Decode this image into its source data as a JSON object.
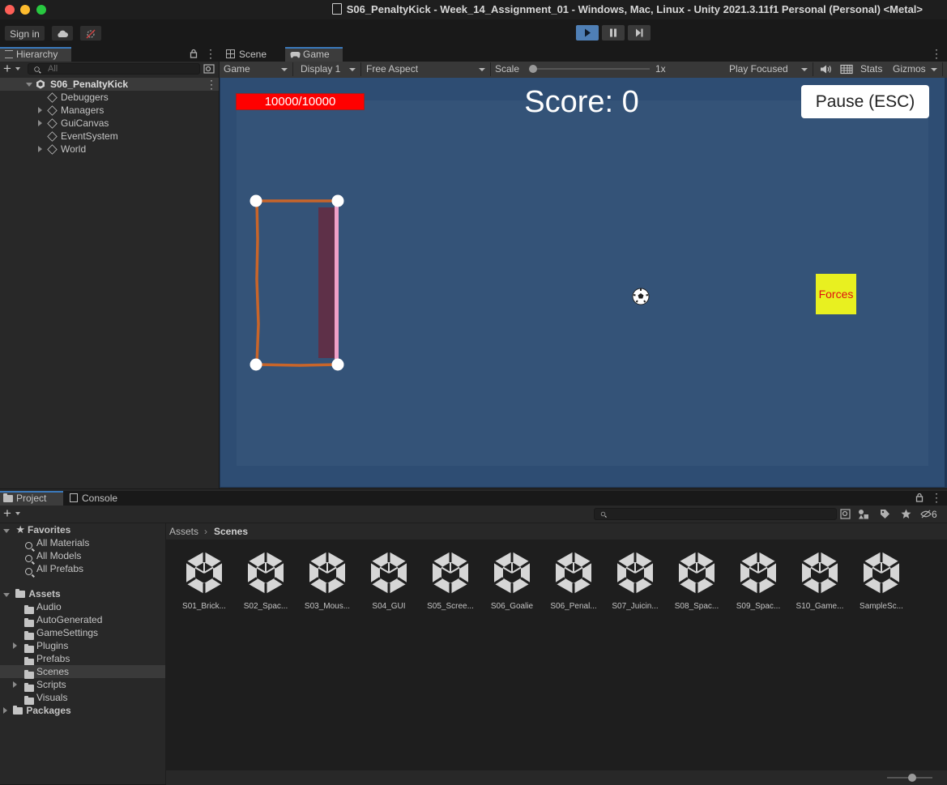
{
  "window": {
    "title": "S06_PenaltyKick - Week_14_Assignment_01 - Windows, Mac, Linux - Unity 2021.3.11f1 Personal (Personal) <Metal>"
  },
  "toolbar": {
    "sign_in": "Sign in"
  },
  "hierarchy": {
    "tab": "Hierarchy",
    "search_placeholder": "All",
    "scene": "S06_PenaltyKick",
    "items": [
      {
        "label": "Debuggers",
        "expandable": false
      },
      {
        "label": "Managers",
        "expandable": true
      },
      {
        "label": "GuiCanvas",
        "expandable": true
      },
      {
        "label": "EventSystem",
        "expandable": false
      },
      {
        "label": "World",
        "expandable": true
      }
    ]
  },
  "view_tabs": {
    "scene": "Scene",
    "game": "Game"
  },
  "game_toolbar": {
    "mode": "Game",
    "display": "Display 1",
    "aspect": "Free Aspect",
    "scale_label": "Scale",
    "scale_value": "1x",
    "play_focused": "Play Focused",
    "stats": "Stats",
    "gizmos": "Gizmos"
  },
  "game": {
    "health": "10000/10000",
    "health_fraction": 1.0,
    "score": "Score: 0",
    "pause": "Pause (ESC)",
    "forces": "Forces"
  },
  "bottom_tabs": {
    "project": "Project",
    "console": "Console"
  },
  "project": {
    "hidden_count": "6",
    "favorites": {
      "label": "Favorites",
      "items": [
        "All Materials",
        "All Models",
        "All Prefabs"
      ]
    },
    "assets": {
      "label": "Assets",
      "items": [
        {
          "label": "Audio",
          "expandable": false
        },
        {
          "label": "AutoGenerated",
          "expandable": false
        },
        {
          "label": "GameSettings",
          "expandable": false
        },
        {
          "label": "Plugins",
          "expandable": true
        },
        {
          "label": "Prefabs",
          "expandable": false
        },
        {
          "label": "Scenes",
          "expandable": false,
          "selected": true
        },
        {
          "label": "Scripts",
          "expandable": true
        },
        {
          "label": "Visuals",
          "expandable": false
        }
      ]
    },
    "packages": "Packages",
    "breadcrumb": [
      "Assets",
      "Scenes"
    ],
    "scenes": [
      "S01_Brick...",
      "S02_Spac...",
      "S03_Mous...",
      "S04_GUI",
      "S05_Scree...",
      "S06_Goalie",
      "S06_Penal...",
      "S07_Juicin...",
      "S08_Spac...",
      "S09_Spac...",
      "S10_Game...",
      "SampleSc..."
    ]
  },
  "colors": {
    "accent": "#3a79bb",
    "game_bg": "#2e4d73",
    "health_red": "#ff0000",
    "goal_orange": "#c8652a",
    "goal_line_pink": "#f0a0c8",
    "forces_yellow": "#e8f020",
    "forces_text": "#e01010"
  }
}
